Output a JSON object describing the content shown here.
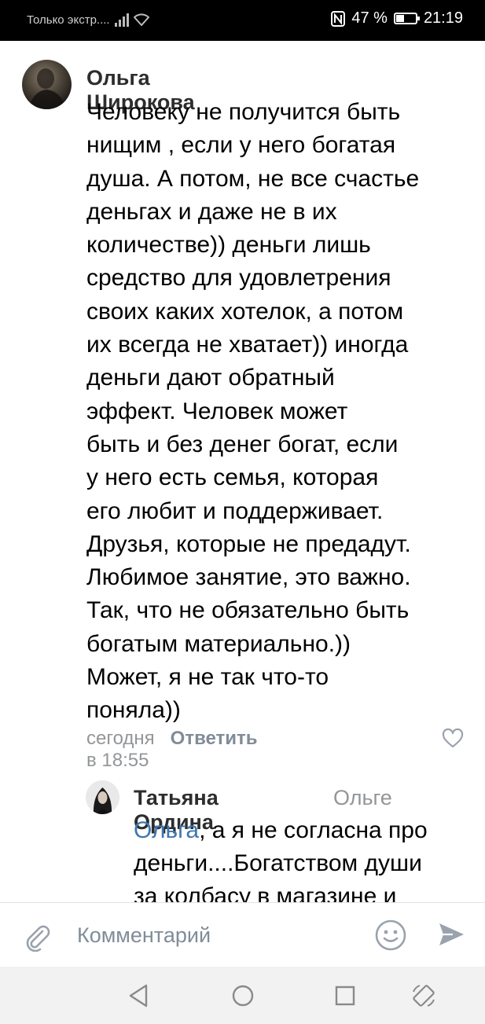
{
  "status_bar": {
    "carrier": "Только экстр....",
    "battery": "47 %",
    "time": "21:19"
  },
  "comment": {
    "author": "Ольга Широкова",
    "text_lines": [
      "Человеку не получится быть",
      "нищим , если у него богатая",
      "душа. А потом, не все счастье",
      "деньгах и даже не в их",
      "количестве)) деньги лишь",
      "средство для удовлетрения",
      "своих каких хотелок, а потом",
      "их всегда не хватает)) иногда",
      "деньги дают обратный",
      "эффект. Человек может",
      "быть и без денег богат, если",
      "у него есть семья, которая",
      "его любит и поддерживает.",
      "Друзья, которые не предадут.",
      "Любимое занятие, это важно.",
      "Так, что не обязательно быть",
      "богатым материально.))",
      "Может, я не так что-то",
      "поняла))"
    ],
    "time": "сегодня в 18:55",
    "reply_label": "Ответить"
  },
  "reply": {
    "author": "Татьяна Ордина",
    "reply_to": "Ольге",
    "mention": "Ольга",
    "line1_rest": ", а я не согласна про",
    "line2": "деньги....Богатством души",
    "line3": "за колбасу в магазине и"
  },
  "input": {
    "placeholder": "Комментарий"
  },
  "icons": {
    "like": "heart-outline-icon",
    "attach": "paperclip-icon",
    "emoji": "smiley-icon",
    "send": "send-arrow-icon"
  },
  "colors": {
    "mention": "#3f77b0",
    "meta": "#939699",
    "icon_gray": "#99a2ad"
  }
}
